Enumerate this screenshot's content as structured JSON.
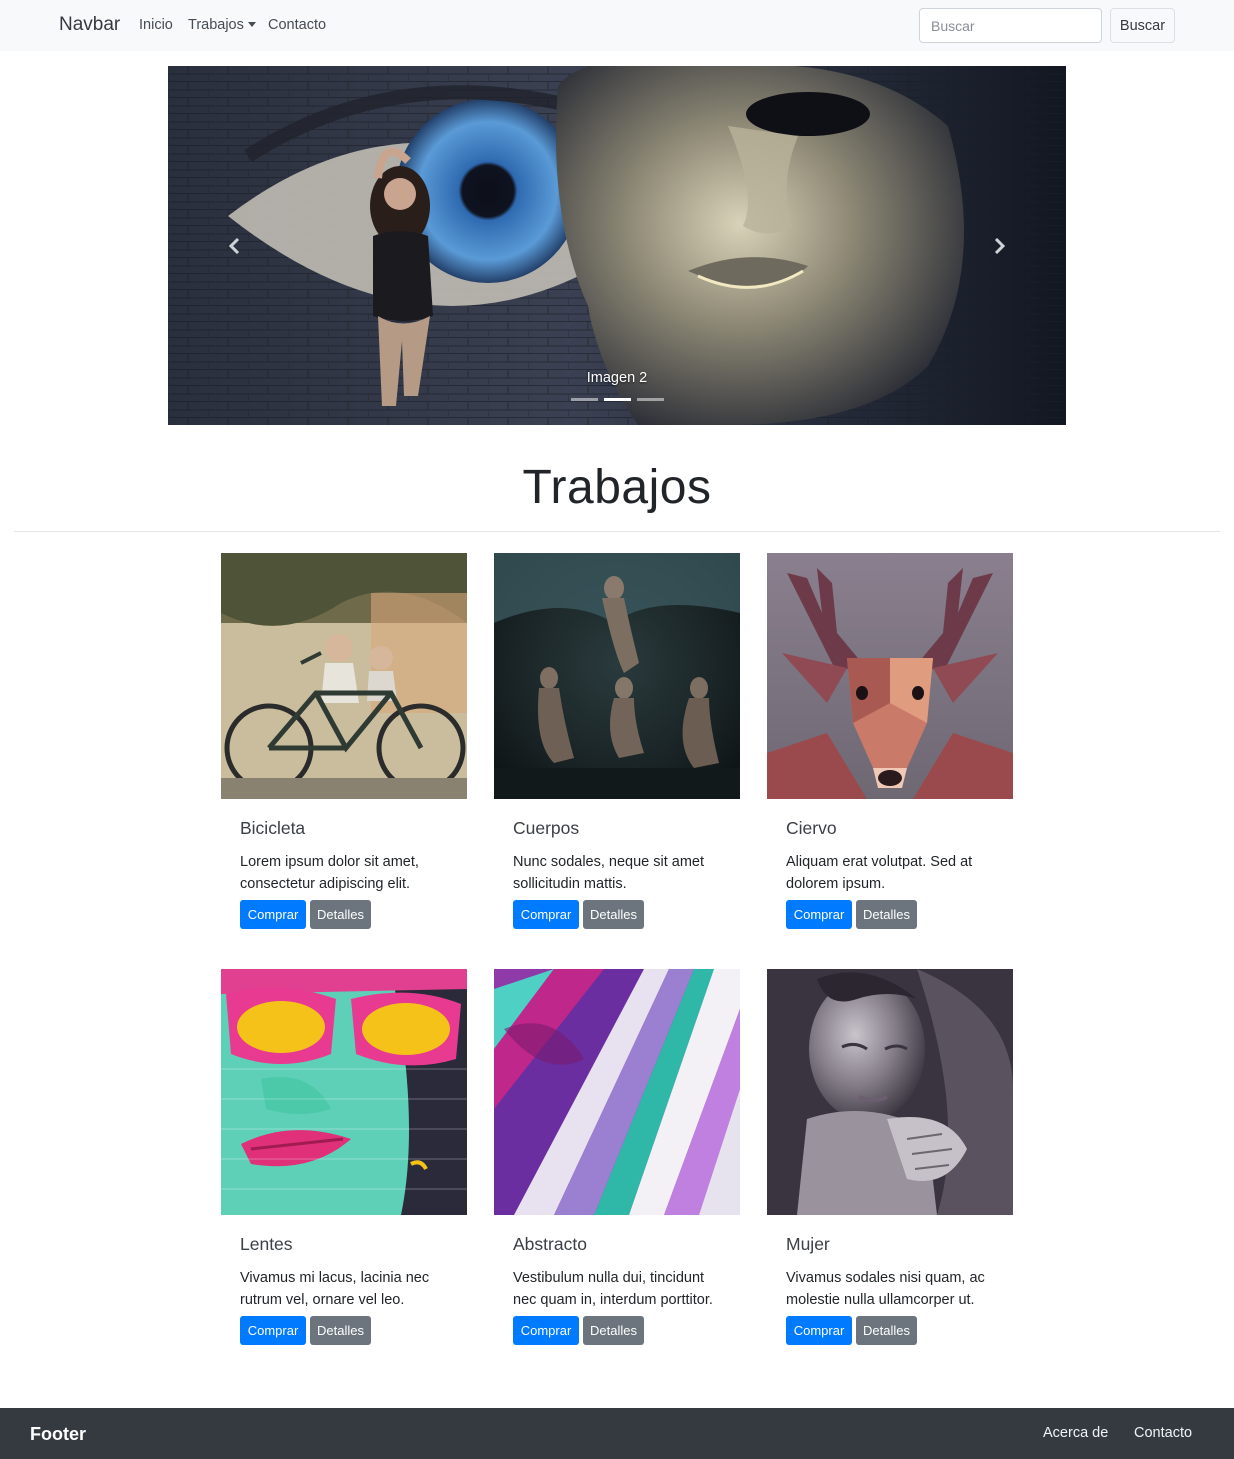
{
  "navbar": {
    "brand": "Navbar",
    "links": [
      "Inicio",
      "Trabajos",
      "Contacto"
    ],
    "search_placeholder": "Buscar",
    "search_button": "Buscar"
  },
  "carousel": {
    "caption": "Imagen 2",
    "indicator_count": 3,
    "active_index": 1
  },
  "section": {
    "title": "Trabajos"
  },
  "cards": [
    {
      "title": "Bicicleta",
      "text": "Lorem ipsum dolor sit amet, consectetur adipiscing elit.",
      "buy": "Comprar",
      "details": "Detalles"
    },
    {
      "title": "Cuerpos",
      "text": "Nunc sodales, neque sit amet sollicitudin mattis.",
      "buy": "Comprar",
      "details": "Detalles"
    },
    {
      "title": "Ciervo",
      "text": "Aliquam erat volutpat. Sed at dolorem ipsum.",
      "buy": "Comprar",
      "details": "Detalles"
    },
    {
      "title": "Lentes",
      "text": "Vivamus mi lacus, lacinia nec rutrum vel, ornare vel leo.",
      "buy": "Comprar",
      "details": "Detalles"
    },
    {
      "title": "Abstracto",
      "text": "Vestibulum nulla dui, tincidunt nec quam in, interdum porttitor.",
      "buy": "Comprar",
      "details": "Detalles"
    },
    {
      "title": "Mujer",
      "text": "Vivamus sodales nisi quam, ac molestie nulla ullamcorper ut.",
      "buy": "Comprar",
      "details": "Detalles"
    }
  ],
  "footer": {
    "brand": "Footer",
    "links": [
      "Acerca de",
      "Contacto"
    ]
  },
  "colors": {
    "primary": "#007bff",
    "secondary": "#6c757d",
    "navbar_bg": "#f8f9fa",
    "footer_bg": "#343a40"
  }
}
